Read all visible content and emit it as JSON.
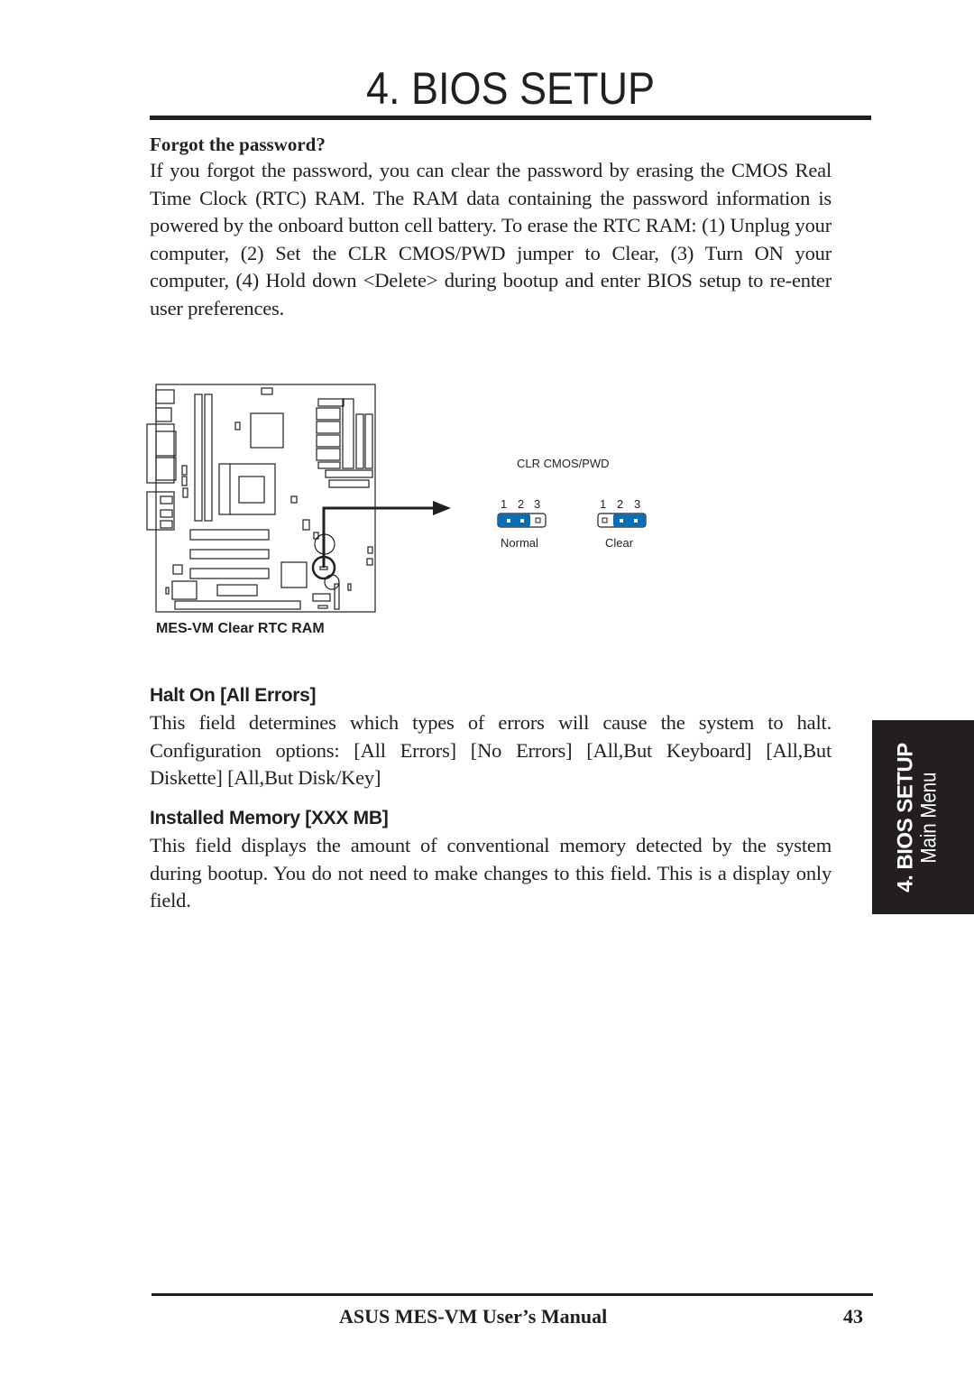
{
  "header": {
    "chapter_title": "4.  BIOS SETUP"
  },
  "sections": {
    "forgot_password": {
      "heading": "Forgot the password?",
      "body": "If you forgot the password, you can clear the password by erasing the CMOS Real Time Clock (RTC) RAM. The RAM data containing the password information is powered by the onboard button cell battery. To erase the RTC RAM: (1) Unplug your computer, (2) Set the CLR CMOS/PWD jumper to Clear, (3) Turn ON your computer, (4) Hold down <Delete> during bootup and enter BIOS setup to re-enter user preferences."
    },
    "halt_on": {
      "heading": "Halt On [All Errors]",
      "body": "This field determines which types of errors will cause the system to halt. Configuration options: [All Errors] [No Errors] [All,But Keyboard] [All,But Diskette] [All,But Disk/Key]"
    },
    "installed_memory": {
      "heading": "Installed Memory [XXX MB]",
      "body": "This field displays the amount of conventional memory detected by the system during bootup. You do not need to make changes to this field. This is a display only field."
    }
  },
  "figure": {
    "caption": "MES-VM Clear RTC RAM",
    "jumper_title": "CLR CMOS/PWD",
    "pin_labels": [
      "1",
      "2",
      "3"
    ],
    "settings": [
      {
        "label": "Normal",
        "shorted_pins": "1-2"
      },
      {
        "label": "Clear",
        "shorted_pins": "2-3"
      }
    ],
    "jumper_color": "#0a6db5"
  },
  "side_tab": {
    "line1": "4.  BIOS SETUP",
    "line2": "Main Menu"
  },
  "footer": {
    "title": "ASUS MES-VM User’s Manual",
    "page_number": "43"
  }
}
